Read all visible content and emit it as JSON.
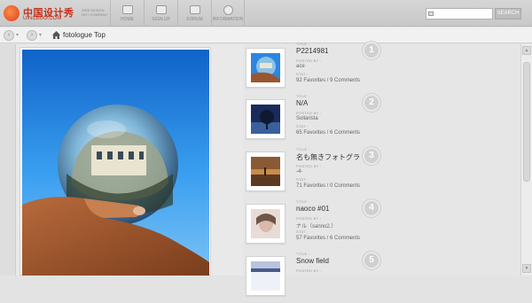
{
  "logo": {
    "cn": "中国设计秀",
    "en": "UINCBUG.COM",
    "sub": "WEB DESIGN HOT COMPANY"
  },
  "nav": [
    {
      "label": "HOME",
      "icon": "home-icon"
    },
    {
      "label": "SIGN UP",
      "icon": "signup-icon"
    },
    {
      "label": "FORUM",
      "icon": "forum-icon"
    },
    {
      "label": "INFORMATION",
      "icon": "info-icon"
    }
  ],
  "search": {
    "placeholder": "",
    "button": "SEARCH"
  },
  "breadcrumb": {
    "back": "‹",
    "forward": "›",
    "text": "fotologue Top"
  },
  "labels": {
    "title": "TITLE :",
    "posted_by": "POSTED BY :",
    "stat": "STAT :"
  },
  "entries": [
    {
      "rank": "1",
      "title": "P2214981",
      "user": "ace",
      "stat": "92 Favorites / 9 Comments"
    },
    {
      "rank": "2",
      "title": "N/A",
      "user": "Sollarista",
      "stat": "65 Favorites / 6 Comments"
    },
    {
      "rank": "3",
      "title": "名も無きフォトグラ ...",
      "user": "-4-",
      "stat": "71 Favorites / 0 Comments"
    },
    {
      "rank": "4",
      "title": "naoco #01",
      "user": "ナル（sanno2.）",
      "stat": "57 Favorites / 6 Comments"
    },
    {
      "rank": "5",
      "title": "Snow field",
      "user": "",
      "stat": ""
    }
  ],
  "colors": {
    "brand": "#c8311a",
    "rank_badge": "#d0d0d0",
    "sky": "#2f8fe0"
  }
}
